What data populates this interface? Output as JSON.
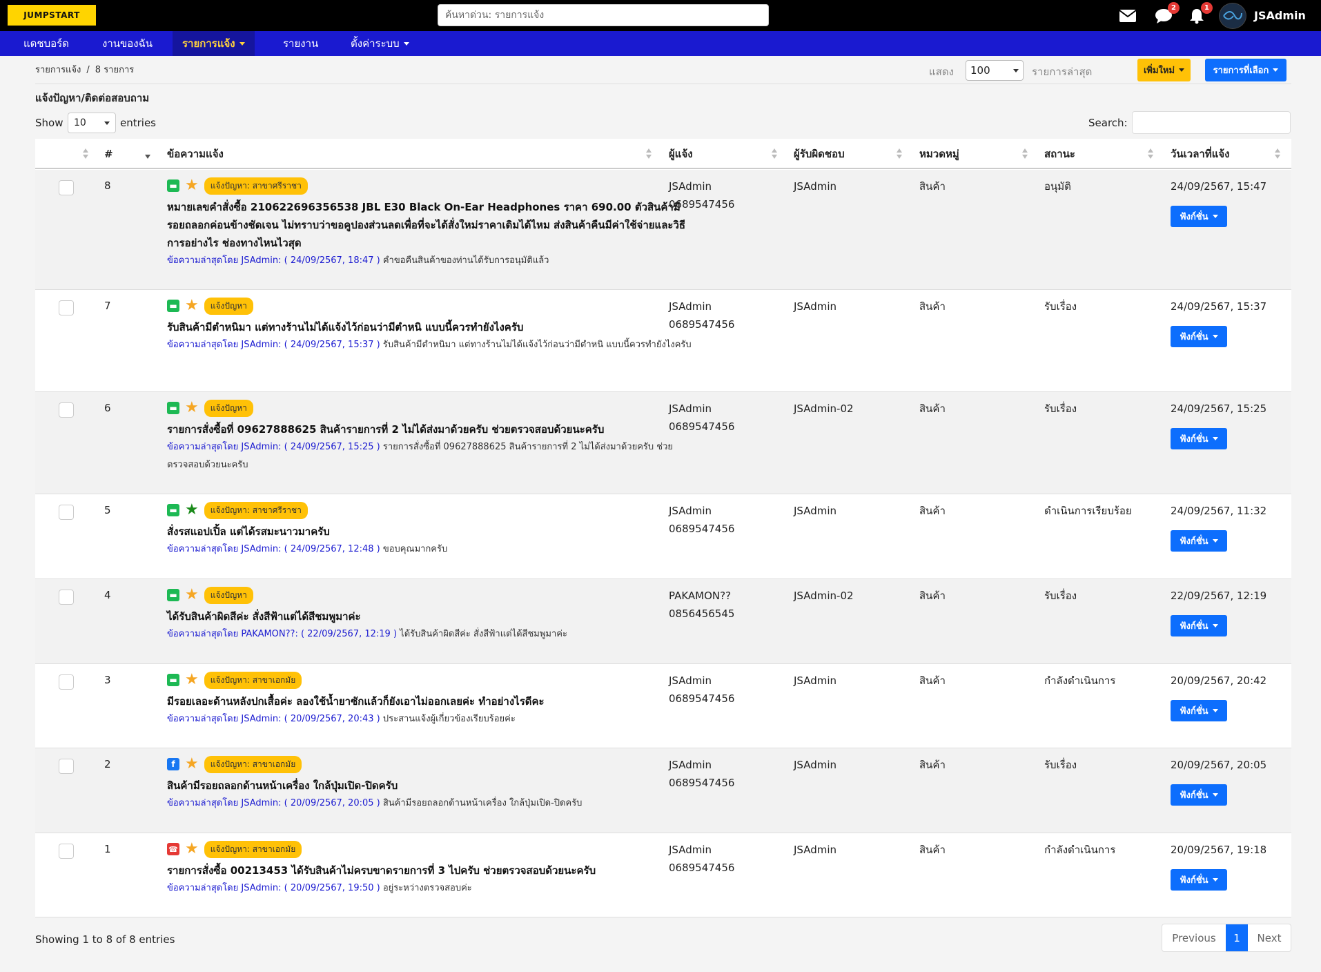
{
  "brand": {
    "logo_text": "JUMPSTART"
  },
  "topbar": {
    "search_placeholder": "ค้นหาด่วน: รายการแจ้ง",
    "icons": [
      {
        "name": "mail-icon",
        "badge": ""
      },
      {
        "name": "chat-icon",
        "badge": "2"
      },
      {
        "name": "bell-icon",
        "badge": "1"
      }
    ],
    "user": "JSAdmin"
  },
  "nav": {
    "items": [
      {
        "label": "แดชบอร์ด",
        "caret": false,
        "active": false
      },
      {
        "label": "งานของฉัน",
        "caret": false,
        "active": false
      },
      {
        "label": "รายการแจ้ง",
        "caret": true,
        "active": true
      },
      {
        "label": "รายงาน",
        "caret": false,
        "active": false
      },
      {
        "label": "ตั้งค่าระบบ",
        "caret": true,
        "active": false
      }
    ]
  },
  "breadcrumb": {
    "root": "รายการแจ้ง",
    "count": "8 รายการ"
  },
  "toolbar": {
    "show_label": "แสดง",
    "show_value": "100",
    "latest_label": "รายการล่าสุด",
    "add_new": "เพิ่มใหม่",
    "selected": "รายการที่เลือก"
  },
  "section_title": "แจ้งปัญหา/ติดต่อสอบถาม",
  "length_menu": {
    "prefix": "Show",
    "value": "10",
    "suffix": "entries"
  },
  "search": {
    "label": "Search:",
    "value": ""
  },
  "table": {
    "columns": [
      "#",
      "ข้อความแจ้ง",
      "ผู้แจ้ง",
      "ผู้รับผิดชอบ",
      "หมวดหมู่",
      "สถานะ",
      "วันเวลาที่แจ้ง"
    ],
    "action_label": "ฟังก์ชั่น",
    "rows": [
      {
        "num": "8",
        "channel": "line",
        "star": "#f5a623",
        "tag": "แจ้งปัญหา: สาขาศรีราชา",
        "subject": "หมายเลขคำสั่งซื้อ 210622696356538 JBL E30 Black On-Ear Headphones ราคา 690.00 ตัวสินค้ามีรอยถลอกค่อนข้างชัดเจน ไม่ทราบว่าขอคูปองส่วนลดเพื่อที่จะได้สั่งใหม่ราคาเดิมได้ไหม ส่งสินค้าคืนมีค่าใช้จ่ายและวิธีการอย่างไร ช่องทางไหนไวสุด",
        "latest_by": "ข้อความล่าสุดโดย JSAdmin: ( 24/09/2567, 18:47 )",
        "latest_text": "คำขอคืนสินค้าของท่านได้รับการอนุมัติแล้ว",
        "reporter": "JSAdmin",
        "phone": "0689547456",
        "responsible": "JSAdmin",
        "category": "สินค้า",
        "status": "อนุมัติ",
        "datetime": "24/09/2567, 15:47"
      },
      {
        "num": "7",
        "channel": "line",
        "star": "#f5a623",
        "tag": "แจ้งปัญหา",
        "subject": "รับสินค้ามีตำหนิมา แต่ทางร้านไม่ได้แจ้งไว้ก่อนว่ามีตำหนิ แบบนี้ควรทำยังไงครับ",
        "latest_by": "ข้อความล่าสุดโดย JSAdmin: ( 24/09/2567, 15:37 )",
        "latest_text": "รับสินค้ามีตำหนิมา แต่ทางร้านไม่ได้แจ้งไว้ก่อนว่ามีตำหนิ แบบนี้ควรทำยังไงครับ",
        "reporter": "JSAdmin",
        "phone": "0689547456",
        "responsible": "JSAdmin",
        "category": "สินค้า",
        "status": "รับเรื่อง",
        "datetime": "24/09/2567, 15:37"
      },
      {
        "num": "6",
        "channel": "line",
        "star": "#f5a623",
        "tag": "แจ้งปัญหา",
        "subject": "รายการสั่งซื้อที่ 09627888625 สินค้ารายการที่ 2 ไม่ได้ส่งมาด้วยครับ ช่วยตรวจสอบด้วยนะครับ",
        "latest_by": "ข้อความล่าสุดโดย JSAdmin: ( 24/09/2567, 15:25 )",
        "latest_text": "รายการสั่งซื้อที่ 09627888625 สินค้ารายการที่ 2 ไม่ได้ส่งมาด้วยครับ ช่วยตรวจสอบด้วยนะครับ",
        "reporter": "JSAdmin",
        "phone": "0689547456",
        "responsible": "JSAdmin-02",
        "category": "สินค้า",
        "status": "รับเรื่อง",
        "datetime": "24/09/2567, 15:25"
      },
      {
        "num": "5",
        "channel": "line",
        "star": "#1a8a1a",
        "tag": "แจ้งปัญหา: สาขาศรีราชา",
        "subject": "สั่งรสแอปเปิ้ล แต่ได้รสมะนาวมาครับ",
        "latest_by": "ข้อความล่าสุดโดย JSAdmin: ( 24/09/2567, 12:48 )",
        "latest_text": "ขอบคุณมากครับ",
        "reporter": "JSAdmin",
        "phone": "0689547456",
        "responsible": "JSAdmin",
        "category": "สินค้า",
        "status": "ดำเนินการเรียบร้อย",
        "datetime": "24/09/2567, 11:32"
      },
      {
        "num": "4",
        "channel": "line",
        "star": "#f5a623",
        "tag": "แจ้งปัญหา",
        "subject": "ได้รับสินค้าผิดสีค่ะ สั่งสีฟ้าแต่ได้สีชมพูมาค่ะ",
        "latest_by": "ข้อความล่าสุดโดย PAKAMON??: ( 22/09/2567, 12:19 )",
        "latest_text": "ได้รับสินค้าผิดสีค่ะ สั่งสีฟ้าแต่ได้สีชมพูมาค่ะ",
        "reporter": "PAKAMON??",
        "phone": "0856456545",
        "responsible": "JSAdmin-02",
        "category": "สินค้า",
        "status": "รับเรื่อง",
        "datetime": "22/09/2567, 12:19"
      },
      {
        "num": "3",
        "channel": "line",
        "star": "#f5a623",
        "tag": "แจ้งปัญหา: สาขาเอกมัย",
        "subject": "มีรอยเลอะด้านหลังปกเสื้อค่ะ ลองใช้น้ำยาซักแล้วก็ยังเอาไม่ออกเลยค่ะ ทำอย่างไรดีคะ",
        "latest_by": "ข้อความล่าสุดโดย JSAdmin: ( 20/09/2567, 20:43 )",
        "latest_text": "ประสานแจ้งผู้เกี่ยวข้องเรียบร้อยค่ะ",
        "reporter": "JSAdmin",
        "phone": "0689547456",
        "responsible": "JSAdmin",
        "category": "สินค้า",
        "status": "กำลังดำเนินการ",
        "datetime": "20/09/2567, 20:42"
      },
      {
        "num": "2",
        "channel": "facebook",
        "star": "#f5a623",
        "tag": "แจ้งปัญหา: สาขาเอกมัย",
        "subject": "สินค้ามีรอยถลอกด้านหน้าเครื่อง ใกล้ปุ่มเปิด-ปิดครับ",
        "latest_by": "ข้อความล่าสุดโดย JSAdmin: ( 20/09/2567, 20:05 )",
        "latest_text": "สินค้ามีรอยถลอกด้านหน้าเครื่อง ใกล้ปุ่มเปิด-ปิดครับ",
        "reporter": "JSAdmin",
        "phone": "0689547456",
        "responsible": "JSAdmin",
        "category": "สินค้า",
        "status": "รับเรื่อง",
        "datetime": "20/09/2567, 20:05"
      },
      {
        "num": "1",
        "channel": "phone",
        "star": "#f5a623",
        "tag": "แจ้งปัญหา: สาขาเอกมัย",
        "subject": "รายการสั่งซื้อ 00213453 ได้รับสินค้าไม่ครบขาดรายการที่ 3 ไปครับ ช่วยตรวจสอบด้วยนะครับ",
        "latest_by": "ข้อความล่าสุดโดย JSAdmin: ( 20/09/2567, 19:50 )",
        "latest_text": "อยู่ระหว่างตรวจสอบค่ะ",
        "reporter": "JSAdmin",
        "phone": "0689547456",
        "responsible": "JSAdmin",
        "category": "สินค้า",
        "status": "กำลังดำเนินการ",
        "datetime": "20/09/2567, 19:18"
      }
    ]
  },
  "footer": {
    "info": "Showing 1 to 8 of 8 entries",
    "prev": "Previous",
    "current": "1",
    "next": "Next"
  }
}
